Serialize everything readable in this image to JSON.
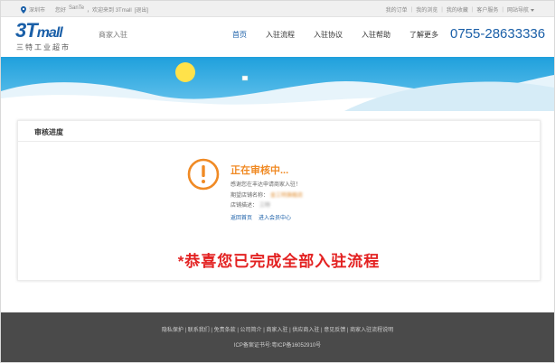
{
  "topbar": {
    "location": "深圳市",
    "greeting": "您好",
    "username": "SanTe",
    "welcome": "，欢迎来到 3Tmall",
    "logout": "[退出]",
    "links": [
      "我的订单",
      "我的浏览",
      "我的收藏",
      "客户服务",
      "网站导航"
    ]
  },
  "header": {
    "logo_text": "3T",
    "logo_suffix": "mall",
    "logo_sub": "三特工业超市",
    "subtitle": "商家入驻",
    "nav": [
      "首页",
      "入驻流程",
      "入驻协议",
      "入驻帮助",
      "了解更多"
    ],
    "phone": "0755-28633336"
  },
  "card": {
    "title": "审核进度",
    "status_heading": "正在审核中...",
    "status_message": "感谢您在丰达申请商家入驻！",
    "shop_name_label": "期望店铺名称：",
    "shop_name_value": "金三特旗舰店",
    "shop_desc_label": "店铺描述：",
    "shop_desc_value": "三特",
    "link_home": "返回首页",
    "link_member": "进入会员中心",
    "congrats": "*恭喜您已完成全部入驻流程"
  },
  "footer": {
    "links": "隐私保护 | 联系我们 | 免责条款 | 公司简介 | 商家入驻 | 供应商入驻 | 意见反馈 | 商家入驻流程说明",
    "icp": "ICP备案证书号:粤ICP备16052910号"
  },
  "colors": {
    "brand_blue": "#1a5fa8",
    "status_orange": "#f08a24",
    "congrats_red": "#e32222",
    "footer_bg": "#4a4a4a",
    "banner_sky": "#29a8df"
  },
  "icons": {
    "location": "location-pin-icon",
    "status": "exclamation-circle-icon",
    "banner_sun": "sun-icon"
  }
}
